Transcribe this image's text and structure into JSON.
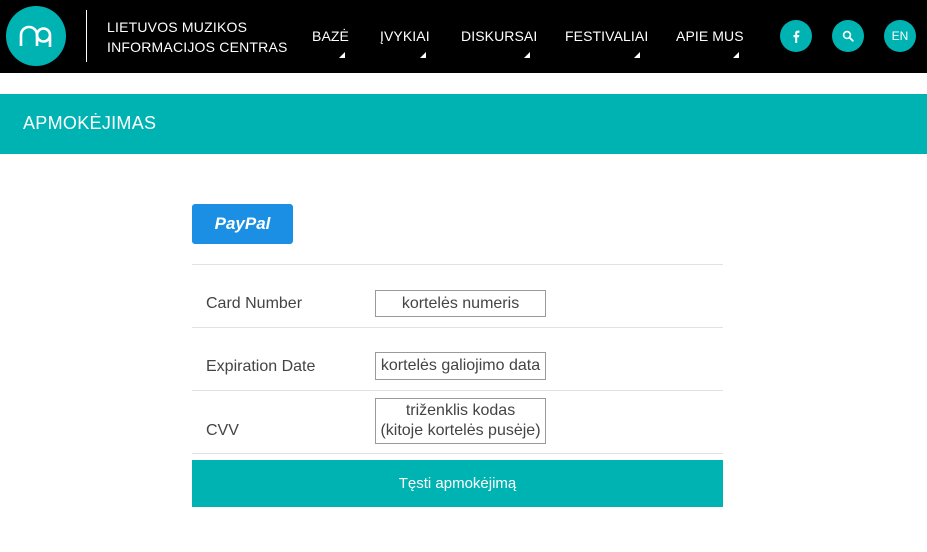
{
  "header": {
    "org_line1": "LIETUVOS MUZIKOS",
    "org_line2": "INFORMACIJOS CENTRAS",
    "nav": [
      {
        "label": "BAZĖ"
      },
      {
        "label": "ĮVYKIAI"
      },
      {
        "label": "DISKURSAI"
      },
      {
        "label": "FESTIVALIAI"
      },
      {
        "label": "APIE MUS"
      }
    ],
    "icons": {
      "facebook": "facebook-icon",
      "search": "search-icon",
      "logo": "mic-logo"
    },
    "lang": "EN"
  },
  "page": {
    "title": "APMOKĖJIMAS"
  },
  "payment": {
    "paypal_label": "PayPal",
    "rows": [
      {
        "label": "Card Number",
        "value": "kortelės numeris"
      },
      {
        "label": "Expiration Date",
        "value": "kortelės galiojimo data"
      },
      {
        "label": "CVV",
        "value_line1": "triženklis kodas",
        "value_line2": "(kitoje kortelės pusėje)"
      }
    ],
    "submit_label": "Tęsti apmokėjimą"
  },
  "colors": {
    "accent": "#00b3b3",
    "header_bg": "#000000",
    "paypal_blue": "#1a8fe3",
    "text": "#444444"
  }
}
